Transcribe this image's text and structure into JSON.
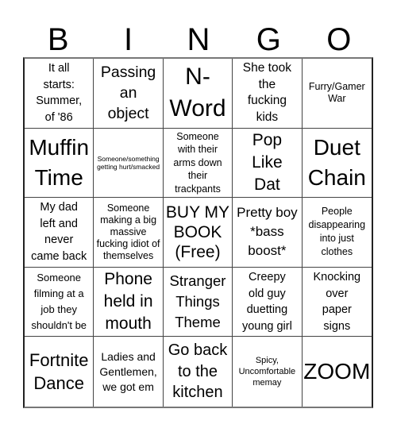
{
  "header": {
    "letters": [
      "B",
      "I",
      "N",
      "G",
      "O"
    ]
  },
  "cells": [
    "It all\nstarts:\nSummer,\nof '86",
    "Passing\nan\nobject",
    "N-\nWord",
    "She took\nthe\nfucking\nkids",
    "Furry/Gamer\nWar",
    "Muffin\nTime",
    "Someone/something\ngetting hurt/smacked",
    "Someone\nwith their\narms down\ntheir\ntrackpants",
    "Pop\nLike\nDat",
    "Duet\nChain",
    "My dad\nleft and\nnever\ncame back",
    "Someone\nmaking a big\nmassive\nfucking idiot of\nthemselves",
    "BUY MY\nBOOK\n(Free)",
    "Pretty boy\n*bass\nboost*",
    "People\ndisappearing\ninto just\nclothes",
    "Someone\nfilming at a\njob they\nshouldn't be",
    "Phone\nheld in\nmouth",
    "Stranger\nThings\nTheme",
    "Creepy\nold guy\nduetting\nyoung girl",
    "Knocking\nover\npaper\nsigns",
    "Fortnite\nDance",
    "Ladies and\nGentlemen,\nwe got em",
    "Go back\nto the\nkitchen",
    "Spicy,\nUncomfortable\nmemay",
    "ZOOM"
  ]
}
